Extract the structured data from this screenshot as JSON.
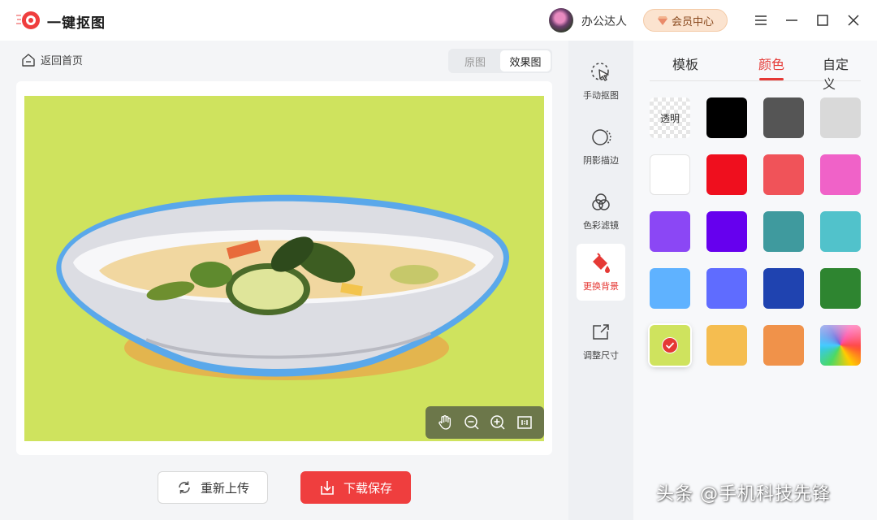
{
  "app": {
    "title": "一键抠图"
  },
  "header": {
    "username": "办公达人",
    "vip_label": "会员中心"
  },
  "nav": {
    "back_label": "返回首页"
  },
  "view_toggle": {
    "options": [
      "原图",
      "效果图"
    ],
    "selected": "效果图"
  },
  "canvas": {
    "background_color": "#cfe35e"
  },
  "actions": {
    "reupload_label": "重新上传",
    "download_label": "下载保存"
  },
  "tools": [
    {
      "label": "手动抠图",
      "icon": "cursor-select-icon"
    },
    {
      "label": "阴影描边",
      "icon": "shadow-outline-icon"
    },
    {
      "label": "色彩滤镜",
      "icon": "color-filter-icon"
    },
    {
      "label": "更换背景",
      "icon": "paint-bucket-icon",
      "active": true
    },
    {
      "label": "调整尺寸",
      "icon": "resize-icon"
    }
  ],
  "panel": {
    "tabs": [
      "模板",
      "颜色",
      "自定义"
    ],
    "active_tab": "颜色",
    "transparent_label": "透明",
    "swatches": [
      "transparent",
      "#000000",
      "#555555",
      "#d9d9d9",
      "#ffffff",
      "#ef0f1e",
      "#f05359",
      "#f062c8",
      "#8b47f5",
      "#6600ee",
      "#3f9a9e",
      "#51c2cb",
      "#5fb2ff",
      "#5f6cff",
      "#1f43b0",
      "#2e8530",
      "#cfe35e",
      "#f5bd50",
      "#f0924a",
      "rainbow"
    ],
    "selected_color": "#cfe35e"
  },
  "watermark": "头条 @手机科技先锋"
}
